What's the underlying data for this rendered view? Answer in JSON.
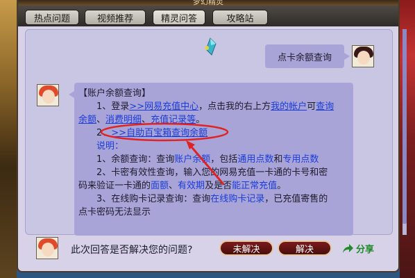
{
  "window": {
    "title": "梦幻精灵"
  },
  "tabs": [
    {
      "label": "热点问题"
    },
    {
      "label": "视频推荐"
    },
    {
      "label": "精灵问答",
      "active": true
    },
    {
      "label": "攻略站"
    }
  ],
  "chat": {
    "user_question": "点卡余额查询",
    "answer": {
      "heading": "【账户余额查询】",
      "l1_pre": "1、登录",
      "l1_link": ">>网易充值中心",
      "l1_mid": "，点击我的右上方",
      "l1_link2": "我的帐户",
      "l1_mid2": "可",
      "l1_link3": "查询",
      "l1b_link": "余额",
      "l1b_sep": "、",
      "l1b_link2": "消费明细",
      "l1b_sep2": "、",
      "l1b_link3": "充值记录等",
      "l1b_end": "。",
      "l2_pre": "2、",
      "l2_link": ">>自助百宝箱查询余额",
      "explain": "说明：",
      "e1_pre": "1、余额查询：查询",
      "e1_hl": "账户余额",
      "e1_mid": "，包括",
      "e1_hl2": "通用点数",
      "e1_mid2": "和",
      "e1_hl3": "专用点数",
      "e2a": "2、卡密有效性查询，输入您的网易充值一卡通的卡号和密",
      "e2b_pre": "码来验证一卡通的",
      "e2b_hl": "面额",
      "e2b_sep": "、",
      "e2b_hl2": "有效期",
      "e2b_mid": "及是否",
      "e2b_hl3": "能正常充值",
      "e2b_end": "。",
      "e3a_pre": "3、在线购卡记录查询：查询",
      "e3a_hl": "在线购卡记录",
      "e3a_end": "，已充值寄售的",
      "e3b": "点卡密码无法显示"
    }
  },
  "feedback": {
    "question": "此次回答是否解决您的问题?",
    "unsolved_label": "未解决",
    "solved_label": "解决",
    "share_label": "分享"
  },
  "colors": {
    "bubble": "#a9a4d8",
    "link": "#1a3bd8",
    "annotation": "#e02222",
    "button": "#6a1414",
    "share": "#1f8a2a"
  }
}
